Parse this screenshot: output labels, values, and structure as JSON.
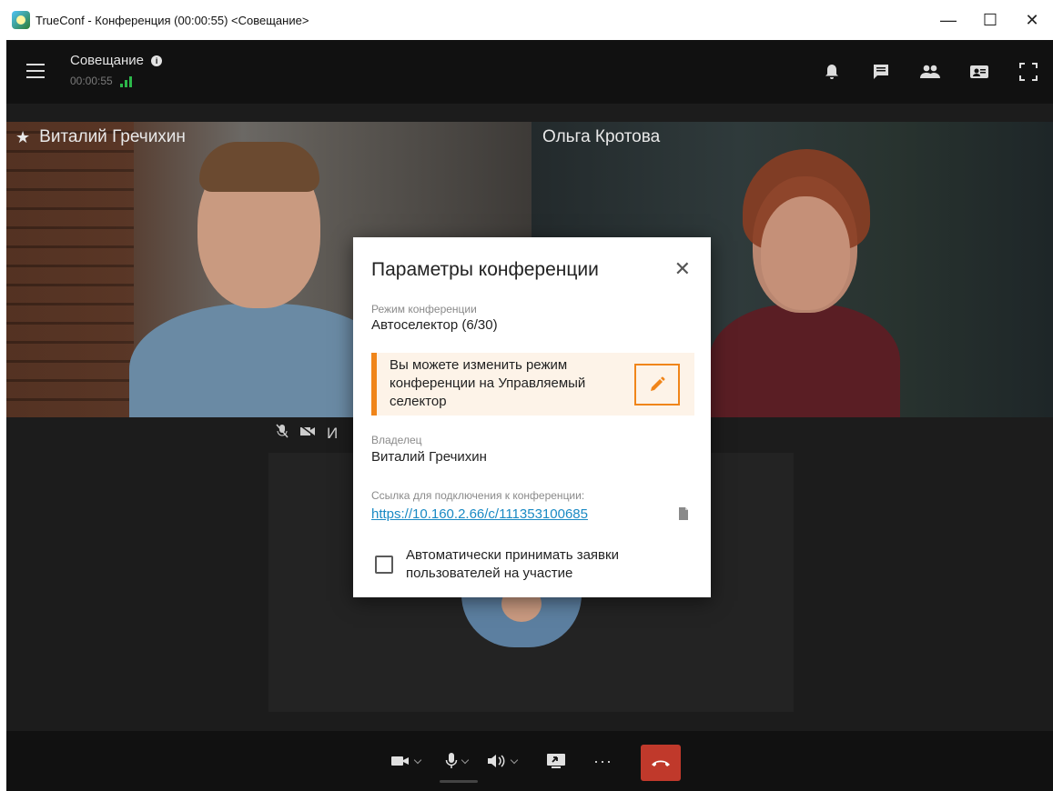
{
  "window": {
    "title": "TrueConf - Конференция (00:00:55) <Совещание>",
    "minimize_glyph": "—",
    "maximize_glyph": "☐",
    "close_glyph": "✕"
  },
  "header": {
    "conference_name": "Совещание",
    "info_glyph": "i",
    "timer": "00:00:55",
    "icons": [
      "bell-icon",
      "chat-icon",
      "participants-icon",
      "content-icon",
      "fullscreen-icon"
    ]
  },
  "participants": {
    "left": {
      "name": "Виталий Гречихин",
      "star_glyph": "★"
    },
    "right": {
      "name": "Ольга Кротова"
    },
    "bottom_partial_label": "И"
  },
  "dialog": {
    "title": "Параметры конференции",
    "close_glyph": "✕",
    "mode_label": "Режим конференции",
    "mode_value": "Автоселектор (6/30)",
    "notice_text": "Вы можете изменить режим конференции на Управляемый селектор",
    "owner_label": "Владелец",
    "owner_value": "Виталий Гречихин",
    "link_label": "Ссылка для подключения к конференции:",
    "link_value": "https://10.160.2.66/c/111353100685",
    "auto_accept_label": "Автоматически принимать заявки пользователей на участие",
    "auto_accept_checked": false,
    "accent_color": "#f0851a",
    "link_color": "#1a8ac4"
  },
  "toolbar": {
    "more_glyph": "···",
    "icons": [
      "camera-icon",
      "microphone-icon",
      "speaker-icon",
      "share-screen-icon",
      "more-icon",
      "hangup-icon"
    ],
    "hangup_color": "#c0392b"
  }
}
